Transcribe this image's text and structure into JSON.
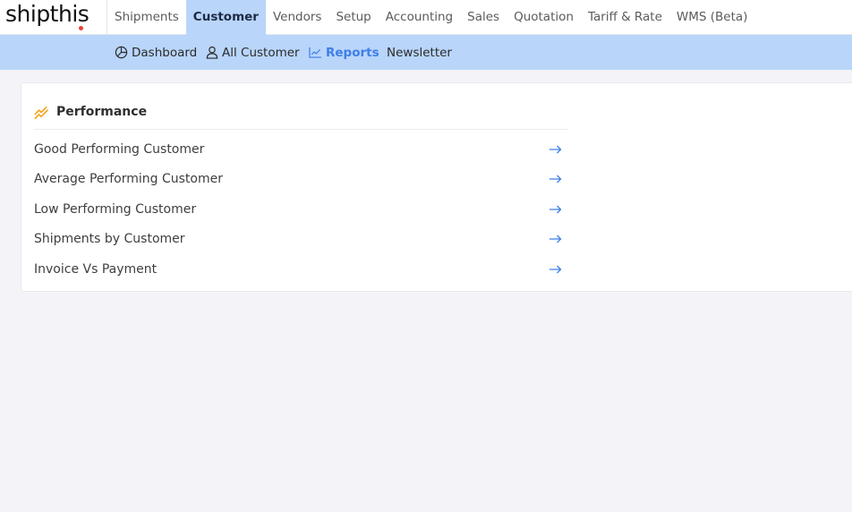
{
  "brand": {
    "logo_text": "shipthis"
  },
  "main_nav": [
    {
      "label": "Shipments"
    },
    {
      "label": "Customer"
    },
    {
      "label": "Vendors"
    },
    {
      "label": "Setup"
    },
    {
      "label": "Accounting"
    },
    {
      "label": "Sales"
    },
    {
      "label": "Quotation"
    },
    {
      "label": "Tariff & Rate"
    },
    {
      "label": "WMS (Beta)"
    }
  ],
  "sub_nav": [
    {
      "label": "Dashboard",
      "icon": "pie-chart-icon"
    },
    {
      "label": "All Customer",
      "icon": "user-icon"
    },
    {
      "label": "Reports",
      "icon": "line-chart-icon"
    },
    {
      "label": "Newsletter"
    }
  ],
  "performance": {
    "title": "Performance",
    "icon": "trending-icon",
    "items": [
      {
        "label": "Good Performing Customer"
      },
      {
        "label": "Average Performing Customer"
      },
      {
        "label": "Low Performing Customer"
      },
      {
        "label": "Shipments by Customer"
      },
      {
        "label": "Invoice Vs Payment"
      }
    ]
  },
  "colors": {
    "accent_blue": "#3f7ee8",
    "subnav_bg": "#b9d5fa",
    "trending_icon": "#f5a623",
    "logo_dot": "#e8403a"
  }
}
